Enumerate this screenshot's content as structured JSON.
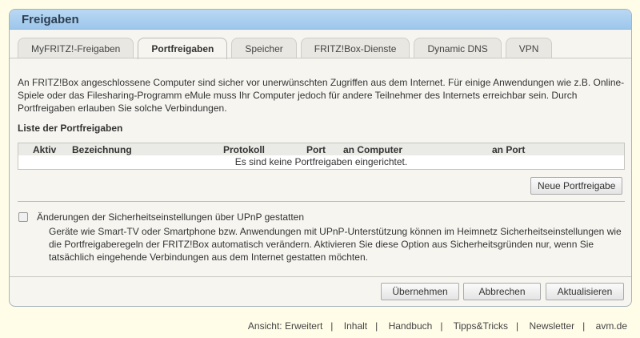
{
  "title": "Freigaben",
  "tabs": [
    "MyFRITZ!-Freigaben",
    "Portfreigaben",
    "Speicher",
    "FRITZ!Box-Dienste",
    "Dynamic DNS",
    "VPN"
  ],
  "intro": "An FRITZ!Box angeschlossene Computer sind sicher vor unerwünschten Zugriffen aus dem Internet. Für einige Anwendungen wie z.B. Online-Spiele oder das Filesharing-Programm eMule muss Ihr Computer jedoch für andere Teilnehmer des Internets erreichbar sein. Durch Portfreigaben erlauben Sie solche Verbindungen.",
  "list_title": "Liste der Portfreigaben",
  "columns": [
    "Aktiv",
    "Bezeichnung",
    "Protokoll",
    "Port",
    "an Computer",
    "an Port"
  ],
  "empty": "Es sind keine Portfreigaben eingerichtet.",
  "new_button": "Neue Portfreigabe",
  "upnp_label": "Änderungen der Sicherheitseinstellungen über UPnP gestatten",
  "upnp_checked": false,
  "upnp_desc": "Geräte wie Smart-TV oder Smartphone bzw. Anwendungen mit UPnP-Unterstützung können im Heimnetz Sicherheitseinstellungen wie die Portfreigaberegeln der FRITZ!Box automatisch verändern. Aktivieren Sie diese Option aus Sicherheitsgründen nur, wenn Sie tatsächlich eingehende Verbindungen aus dem Internet gestatten möchten.",
  "buttons": {
    "apply": "Übernehmen",
    "cancel": "Abbrechen",
    "refresh": "Aktualisieren"
  },
  "footer": {
    "view": "Ansicht: Erweitert",
    "links": [
      "Inhalt",
      "Handbuch",
      "Tipps&Tricks",
      "Newsletter",
      "avm.de"
    ],
    "sep": "|"
  }
}
